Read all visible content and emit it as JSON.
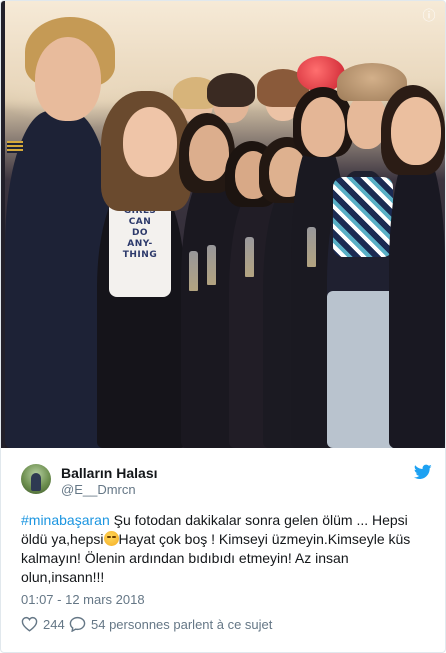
{
  "media": {
    "shirt_text": "GIRLS CAN DO ANY- THING",
    "corner_icon": "info-icon"
  },
  "tweet": {
    "author_name": "Balların Halası",
    "author_handle": "@E__Dmrcn",
    "hashtag": "#minabaşaran",
    "text_part1": " Şu fotodan dakikalar sonra gelen ölüm ... Hepsi öldü ya,hepsi",
    "emoji": "pensive-face-emoji",
    "text_part2": "Hayat çok boş ! Kimseyi üzmeyin.Kimseyle küs kalmayın! Ölenin ardından bıdıbıdı etmeyin! Az insan olun,insann!!!",
    "timestamp": "01:07 - 12 mars 2018",
    "likes_count": "244",
    "replies_text": "54 personnes parlent à ce sujet",
    "brand_icon": "twitter-bird-icon",
    "brand_color": "#1da1f2",
    "link_color": "#1b95e0"
  }
}
